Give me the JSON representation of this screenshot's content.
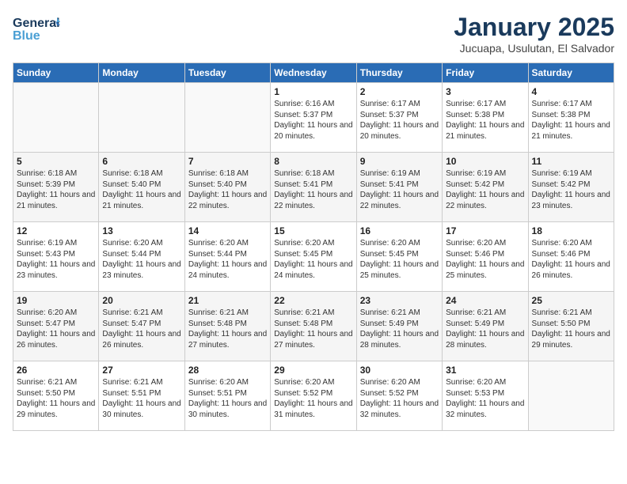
{
  "logo": {
    "line1": "General",
    "line2": "Blue"
  },
  "title": "January 2025",
  "subtitle": "Jucuapa, Usulutan, El Salvador",
  "headers": [
    "Sunday",
    "Monday",
    "Tuesday",
    "Wednesday",
    "Thursday",
    "Friday",
    "Saturday"
  ],
  "weeks": [
    [
      {
        "day": "",
        "info": ""
      },
      {
        "day": "",
        "info": ""
      },
      {
        "day": "",
        "info": ""
      },
      {
        "day": "1",
        "info": "Sunrise: 6:16 AM\nSunset: 5:37 PM\nDaylight: 11 hours and 20 minutes."
      },
      {
        "day": "2",
        "info": "Sunrise: 6:17 AM\nSunset: 5:37 PM\nDaylight: 11 hours and 20 minutes."
      },
      {
        "day": "3",
        "info": "Sunrise: 6:17 AM\nSunset: 5:38 PM\nDaylight: 11 hours and 21 minutes."
      },
      {
        "day": "4",
        "info": "Sunrise: 6:17 AM\nSunset: 5:38 PM\nDaylight: 11 hours and 21 minutes."
      }
    ],
    [
      {
        "day": "5",
        "info": "Sunrise: 6:18 AM\nSunset: 5:39 PM\nDaylight: 11 hours and 21 minutes."
      },
      {
        "day": "6",
        "info": "Sunrise: 6:18 AM\nSunset: 5:40 PM\nDaylight: 11 hours and 21 minutes."
      },
      {
        "day": "7",
        "info": "Sunrise: 6:18 AM\nSunset: 5:40 PM\nDaylight: 11 hours and 22 minutes."
      },
      {
        "day": "8",
        "info": "Sunrise: 6:18 AM\nSunset: 5:41 PM\nDaylight: 11 hours and 22 minutes."
      },
      {
        "day": "9",
        "info": "Sunrise: 6:19 AM\nSunset: 5:41 PM\nDaylight: 11 hours and 22 minutes."
      },
      {
        "day": "10",
        "info": "Sunrise: 6:19 AM\nSunset: 5:42 PM\nDaylight: 11 hours and 22 minutes."
      },
      {
        "day": "11",
        "info": "Sunrise: 6:19 AM\nSunset: 5:42 PM\nDaylight: 11 hours and 23 minutes."
      }
    ],
    [
      {
        "day": "12",
        "info": "Sunrise: 6:19 AM\nSunset: 5:43 PM\nDaylight: 11 hours and 23 minutes."
      },
      {
        "day": "13",
        "info": "Sunrise: 6:20 AM\nSunset: 5:44 PM\nDaylight: 11 hours and 23 minutes."
      },
      {
        "day": "14",
        "info": "Sunrise: 6:20 AM\nSunset: 5:44 PM\nDaylight: 11 hours and 24 minutes."
      },
      {
        "day": "15",
        "info": "Sunrise: 6:20 AM\nSunset: 5:45 PM\nDaylight: 11 hours and 24 minutes."
      },
      {
        "day": "16",
        "info": "Sunrise: 6:20 AM\nSunset: 5:45 PM\nDaylight: 11 hours and 25 minutes."
      },
      {
        "day": "17",
        "info": "Sunrise: 6:20 AM\nSunset: 5:46 PM\nDaylight: 11 hours and 25 minutes."
      },
      {
        "day": "18",
        "info": "Sunrise: 6:20 AM\nSunset: 5:46 PM\nDaylight: 11 hours and 26 minutes."
      }
    ],
    [
      {
        "day": "19",
        "info": "Sunrise: 6:20 AM\nSunset: 5:47 PM\nDaylight: 11 hours and 26 minutes."
      },
      {
        "day": "20",
        "info": "Sunrise: 6:21 AM\nSunset: 5:47 PM\nDaylight: 11 hours and 26 minutes."
      },
      {
        "day": "21",
        "info": "Sunrise: 6:21 AM\nSunset: 5:48 PM\nDaylight: 11 hours and 27 minutes."
      },
      {
        "day": "22",
        "info": "Sunrise: 6:21 AM\nSunset: 5:48 PM\nDaylight: 11 hours and 27 minutes."
      },
      {
        "day": "23",
        "info": "Sunrise: 6:21 AM\nSunset: 5:49 PM\nDaylight: 11 hours and 28 minutes."
      },
      {
        "day": "24",
        "info": "Sunrise: 6:21 AM\nSunset: 5:49 PM\nDaylight: 11 hours and 28 minutes."
      },
      {
        "day": "25",
        "info": "Sunrise: 6:21 AM\nSunset: 5:50 PM\nDaylight: 11 hours and 29 minutes."
      }
    ],
    [
      {
        "day": "26",
        "info": "Sunrise: 6:21 AM\nSunset: 5:50 PM\nDaylight: 11 hours and 29 minutes."
      },
      {
        "day": "27",
        "info": "Sunrise: 6:21 AM\nSunset: 5:51 PM\nDaylight: 11 hours and 30 minutes."
      },
      {
        "day": "28",
        "info": "Sunrise: 6:20 AM\nSunset: 5:51 PM\nDaylight: 11 hours and 30 minutes."
      },
      {
        "day": "29",
        "info": "Sunrise: 6:20 AM\nSunset: 5:52 PM\nDaylight: 11 hours and 31 minutes."
      },
      {
        "day": "30",
        "info": "Sunrise: 6:20 AM\nSunset: 5:52 PM\nDaylight: 11 hours and 32 minutes."
      },
      {
        "day": "31",
        "info": "Sunrise: 6:20 AM\nSunset: 5:53 PM\nDaylight: 11 hours and 32 minutes."
      },
      {
        "day": "",
        "info": ""
      }
    ]
  ]
}
